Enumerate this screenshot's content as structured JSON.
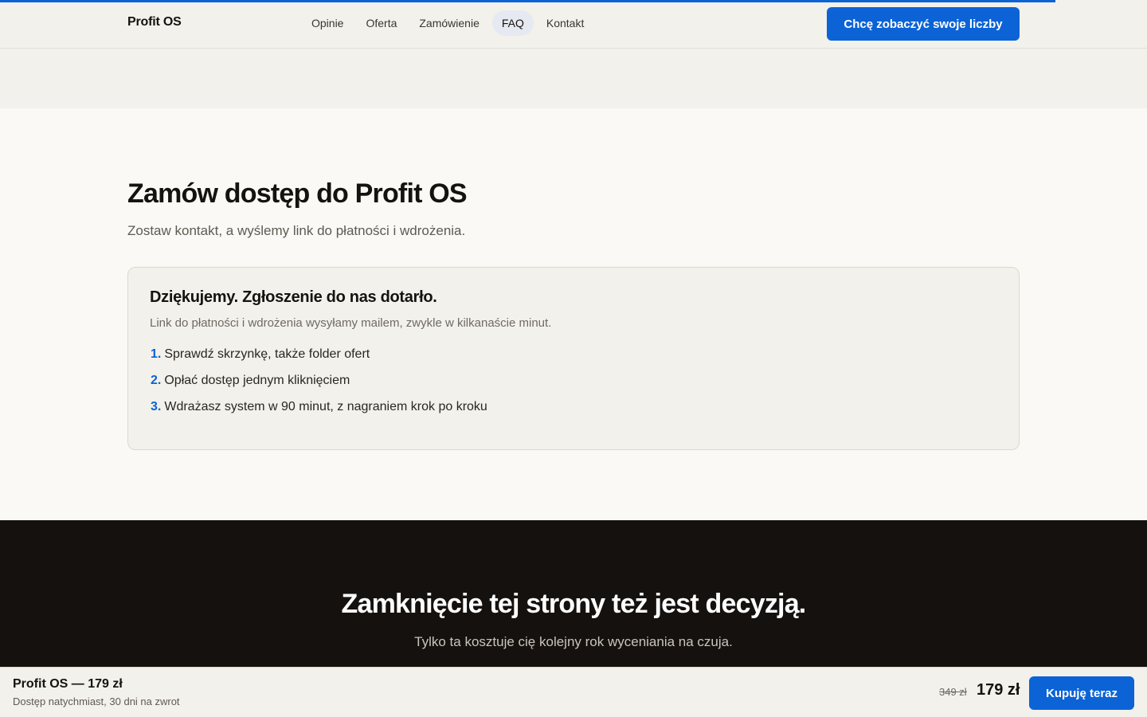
{
  "header": {
    "brand": "Profit OS",
    "nav": [
      "Opinie",
      "Oferta",
      "Zamówienie",
      "FAQ",
      "Kontakt"
    ],
    "active_nav": "FAQ",
    "cta_label": "Chcę zobaczyć swoje liczby"
  },
  "scroll_progress_percent": 92,
  "order": {
    "title": "Zamów dostęp do Profit OS",
    "subtitle": "Zostaw kontakt, a wyślemy link do płatności i wdrożenia.",
    "confirmation": {
      "title": "Dziękujemy. Zgłoszenie do nas dotarło.",
      "subtitle": "Link do płatności i wdrożenia wysyłamy mailem, zwykle w kilkanaście minut.",
      "steps": [
        {
          "num": "1.",
          "text": "Sprawdź skrzynkę, także folder ofert"
        },
        {
          "num": "2.",
          "text": "Opłać dostęp jednym kliknięciem"
        },
        {
          "num": "3.",
          "text": "Wdrażasz system w 90 minut, z nagraniem krok po kroku"
        }
      ]
    }
  },
  "closing": {
    "title": "Zamknięcie tej strony też jest decyzją.",
    "subtitle": "Tylko ta kosztuje cię kolejny rok wyceniania na czuja."
  },
  "sticky_bar": {
    "product": "Profit OS — 179 zł",
    "note": "Dostęp natychmiast, 30 dni na zwrot",
    "price_old": "349 zł",
    "price_new": "179 zł",
    "buy_label": "Kupuję teraz"
  },
  "colors": {
    "accent": "#0b63d6",
    "dark_section": "#15110e",
    "beige": "#f3f1eb"
  }
}
